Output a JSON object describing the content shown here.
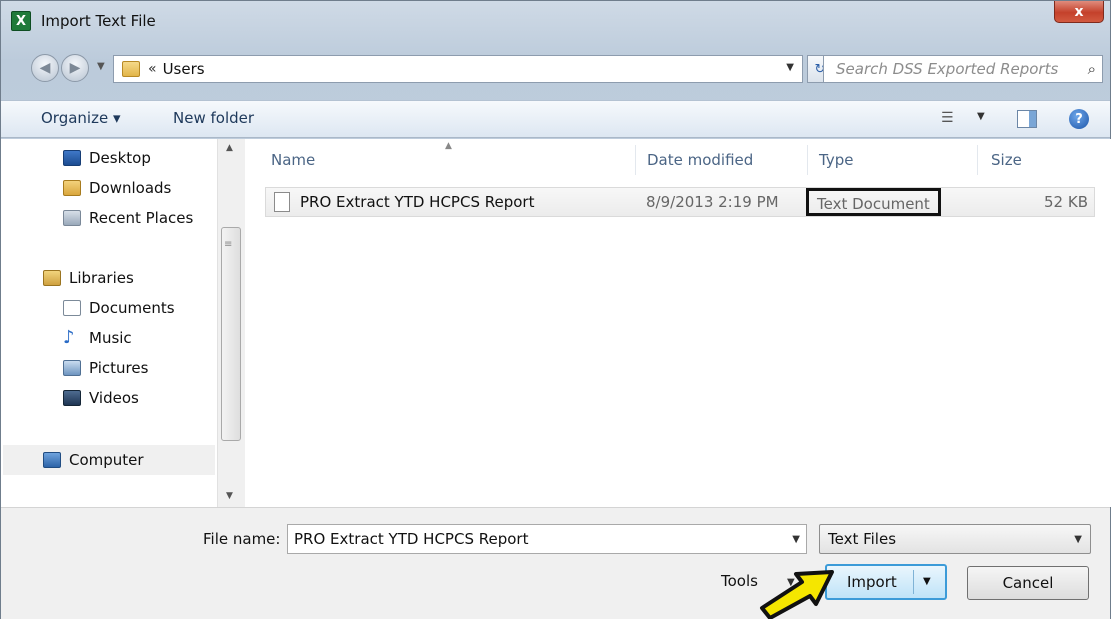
{
  "window": {
    "title": "Import Text File",
    "app_icon_letter": "X",
    "close_glyph": "x"
  },
  "address_bar": {
    "breadcrumb_chevron": "«",
    "path": "Users",
    "search_placeholder": "Search DSS Exported Reports"
  },
  "command_bar": {
    "organize_label": "Organize ▾",
    "new_folder_label": "New folder",
    "help_glyph": "?"
  },
  "nav_pane": {
    "favorites": [
      {
        "label": "Desktop",
        "icon": "desktop-icon"
      },
      {
        "label": "Downloads",
        "icon": "downloads-icon"
      },
      {
        "label": "Recent Places",
        "icon": "recent-places-icon"
      }
    ],
    "libraries_label": "Libraries",
    "libraries": [
      {
        "label": "Documents",
        "icon": "documents-icon"
      },
      {
        "label": "Music",
        "icon": "music-icon"
      },
      {
        "label": "Pictures",
        "icon": "pictures-icon"
      },
      {
        "label": "Videos",
        "icon": "videos-icon"
      }
    ],
    "computer_label": "Computer"
  },
  "file_list": {
    "columns": [
      "Name",
      "Date modified",
      "Type",
      "Size"
    ],
    "rows": [
      {
        "name": "PRO Extract YTD HCPCS Report",
        "date_modified": "8/9/2013 2:19 PM",
        "type": "Text Document",
        "size": "52 KB"
      }
    ]
  },
  "bottom_bar": {
    "file_name_label": "File name:",
    "file_name_value": "PRO Extract YTD HCPCS Report",
    "file_type_value": "Text Files",
    "tools_label": "Tools",
    "import_label": "Import",
    "cancel_label": "Cancel"
  },
  "colors": {
    "highlight_border": "#111111",
    "arrow_fill": "#f5e600",
    "import_border": "#3c9bd8"
  }
}
